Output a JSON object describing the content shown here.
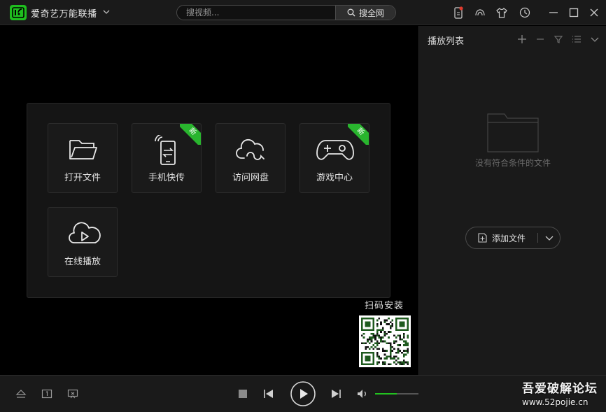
{
  "app": {
    "title": "爱奇艺万能联播"
  },
  "search": {
    "placeholder": "搜视频...",
    "button_label": "搜全网"
  },
  "tiles": [
    {
      "label": "打开文件",
      "icon": "folder-icon",
      "badge": ""
    },
    {
      "label": "手机快传",
      "icon": "phone-transfer-icon",
      "badge": "新"
    },
    {
      "label": "访问网盘",
      "icon": "cloud-drive-icon",
      "badge": ""
    },
    {
      "label": "游戏中心",
      "icon": "gamepad-icon",
      "badge": "新"
    },
    {
      "label": "在线播放",
      "icon": "cloud-play-icon",
      "badge": ""
    }
  ],
  "qr": {
    "label": "扫码安装"
  },
  "playlist": {
    "title": "播放列表",
    "empty_text": "没有符合条件的文件",
    "add_button_label": "添加文件"
  },
  "player": {
    "volume_percent": 50
  },
  "watermark": {
    "title": "吾爱破解论坛",
    "url": "www.52pojie.cn"
  },
  "colors": {
    "accent": "#22c11f",
    "badge": "#29b52e",
    "background": "#000000",
    "panel": "#1a1a1a"
  }
}
